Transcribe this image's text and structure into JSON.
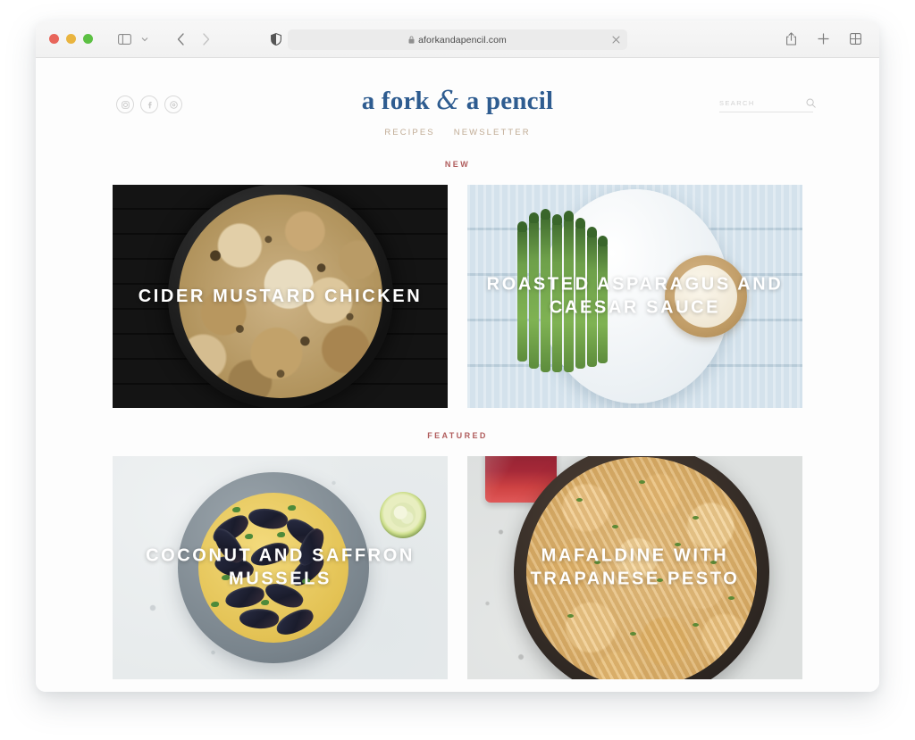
{
  "browser": {
    "traffic_lights": [
      "close",
      "minimize",
      "maximize"
    ],
    "url": "aforkandapencil.com",
    "url_secure": true,
    "toolbar_icons": [
      "sidebar-icon",
      "chevron-down-icon",
      "back-icon",
      "forward-icon",
      "shield-icon",
      "lock-icon",
      "clear-icon",
      "share-icon",
      "new-tab-icon",
      "tab-overview-icon"
    ]
  },
  "site": {
    "logo": {
      "before": "a fork ",
      "amp": "&",
      "after": " a pencil"
    },
    "socials": [
      {
        "name": "instagram",
        "glyph": "◎"
      },
      {
        "name": "facebook",
        "glyph": "f"
      },
      {
        "name": "pinterest",
        "glyph": "ⓟ"
      }
    ],
    "search": {
      "placeholder": "SEARCH",
      "value": ""
    },
    "nav": [
      {
        "label": "RECIPES"
      },
      {
        "label": "NEWSLETTER"
      }
    ],
    "sections": [
      {
        "label": "NEW",
        "cards": [
          {
            "title": "CIDER MUSTARD CHICKEN",
            "art": "chicken"
          },
          {
            "title": "ROASTED ASPARAGUS AND CAESAR SAUCE",
            "art": "asparagus"
          }
        ]
      },
      {
        "label": "FEATURED",
        "cards": [
          {
            "title": "COCONUT AND SAFFRON MUSSELS",
            "art": "mussels"
          },
          {
            "title": "MAFALDINE WITH TRAPANESE PESTO",
            "art": "pasta"
          }
        ]
      }
    ],
    "colors": {
      "logo": "#2e5c90",
      "nav": "#c0ab94",
      "section_label": "#b05c5c",
      "card_title": "#ffffff"
    }
  }
}
